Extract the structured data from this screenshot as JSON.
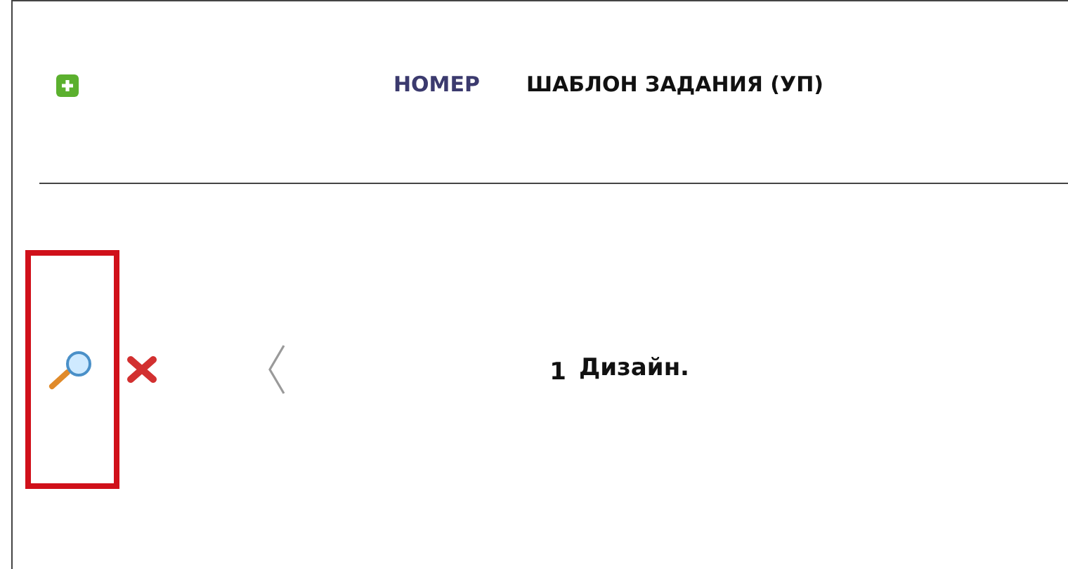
{
  "header": {
    "columns": [
      {
        "kind": "number",
        "label": "НОМЕР"
      },
      {
        "kind": "template",
        "label": "ШАБЛОН ЗАДАНИЯ (УП)"
      }
    ]
  },
  "rows": [
    {
      "number": "1",
      "template": "Дизайн.",
      "highlighted": true
    }
  ]
}
